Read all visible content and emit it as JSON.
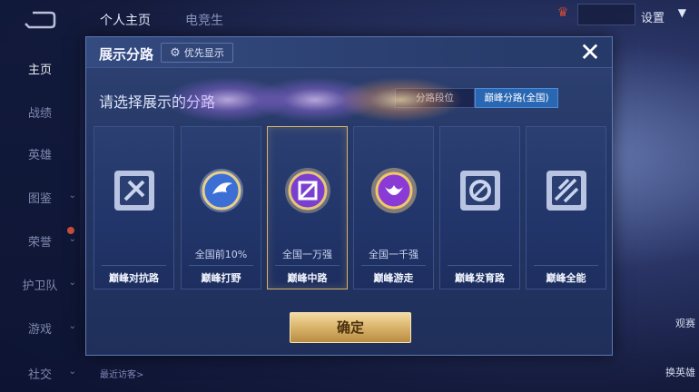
{
  "background": {
    "sidebar_items": [
      {
        "label": "主页",
        "active": true
      },
      {
        "label": "战绩"
      },
      {
        "label": "英雄"
      },
      {
        "label": "图鉴"
      },
      {
        "label": "荣誉"
      },
      {
        "label": "护卫队"
      },
      {
        "label": "游戏"
      },
      {
        "label": "社交"
      }
    ],
    "tabs": [
      "个人主页",
      "电竞生"
    ],
    "settings_label": "设置",
    "right_labels": [
      "观赛",
      "换英雄"
    ],
    "bottom_link": "最近访客>"
  },
  "dialog": {
    "title": "展示分路",
    "priority_button": "优先显示",
    "subtitle": "请选择展示的分路",
    "segments": [
      {
        "label": "分路段位",
        "active": false
      },
      {
        "label": "巅峰分路(全国)",
        "active": true
      }
    ],
    "lanes": [
      {
        "label": "巅峰对抗路",
        "sub": "",
        "selected": false,
        "icon": "clash-lane-icon"
      },
      {
        "label": "巅峰打野",
        "sub": "全国前10%",
        "selected": false,
        "icon": "jungle-badge-icon"
      },
      {
        "label": "巅峰中路",
        "sub": "全国一万强",
        "selected": true,
        "icon": "mid-lane-badge-icon"
      },
      {
        "label": "巅峰游走",
        "sub": "全国一千强",
        "selected": false,
        "icon": "roam-badge-icon"
      },
      {
        "label": "巅峰发育路",
        "sub": "",
        "selected": false,
        "icon": "farm-lane-icon"
      },
      {
        "label": "巅峰全能",
        "sub": "",
        "selected": false,
        "icon": "all-round-icon"
      }
    ],
    "confirm_label": "确定"
  },
  "colors": {
    "accent_gold": "#d9b36a",
    "segment_active": "#2a67b3",
    "dialog_bg": "#253766"
  }
}
